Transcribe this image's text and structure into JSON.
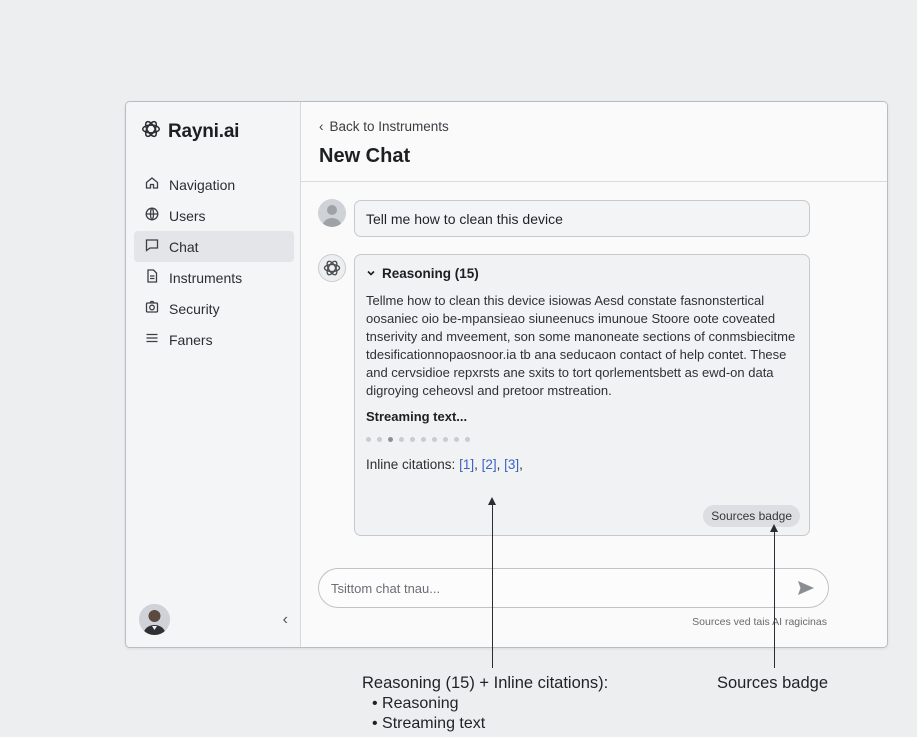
{
  "app": {
    "name": "Rayni.ai"
  },
  "sidebar": {
    "items": [
      {
        "label": "Navigation",
        "icon": "home-icon",
        "active": false
      },
      {
        "label": "Users",
        "icon": "globe-icon",
        "active": false
      },
      {
        "label": "Chat",
        "icon": "chat-icon",
        "active": true
      },
      {
        "label": "Instruments",
        "icon": "document-icon",
        "active": false
      },
      {
        "label": "Security",
        "icon": "camera-icon",
        "active": false
      },
      {
        "label": "Faners",
        "icon": "menu-icon",
        "active": false
      }
    ],
    "collapse_glyph": "‹"
  },
  "header": {
    "back_label": "Back to Instruments",
    "title": "New Chat"
  },
  "chat": {
    "user_message": "Tell me how to clean this device",
    "reasoning": {
      "label": "Reasoning (15)",
      "text": "Tellme how to clean this device isiowas Aesd constate fasnonstertical oosaniec oio be-mpansieao siuneenucs imunoue Stoore oote coveated tnserivity and mveement, son some manoneate sections of conmsbiecitme tdesificationnopaosnoor.ia tb ana seducaon contact of help contet. These and cervsidioe repxrsts ane sxits to tort qorlementsbett as ewd-on data digroying ceheovsl and pretoor mstreation.",
      "streaming_label": "Streaming text...",
      "citations_label": "Inline citations:",
      "citations": [
        "[1]",
        "[2]",
        "[3]"
      ],
      "sources_badge": "Sources badge"
    },
    "composer": {
      "placeholder": "Tsittom chat tnau..."
    },
    "footnote": "Sources ved tais AI ragicinas"
  },
  "annotations": {
    "left_title": "Reasoning (15) + Inline citations):",
    "left_items": [
      "Reasoning",
      "Streaming text"
    ],
    "right_title": "Sources badge"
  },
  "colors": {
    "background": "#eceef0",
    "accent_citation": "#3a63c4",
    "active_nav": "#e3e5e8"
  }
}
